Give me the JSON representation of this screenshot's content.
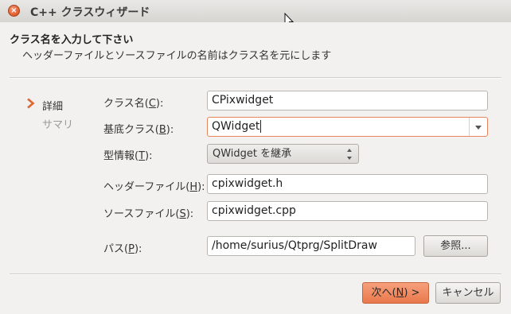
{
  "window": {
    "title": "C++ クラスウィザード",
    "close_symbol": "×"
  },
  "header": {
    "title": "クラス名を入力して下さい",
    "subtitle": "ヘッダーファイルとソースファイルの名前はクラス名を元にします"
  },
  "steps": {
    "current_marker": "❯",
    "details": "詳細",
    "summary": "サマリ"
  },
  "form": {
    "class_name": {
      "label": "クラス名",
      "mnemonic": "C",
      "value": "CPixwidget"
    },
    "base_class": {
      "label": "基底クラス",
      "mnemonic": "B",
      "value": "QWidget"
    },
    "type_info": {
      "label": "型情報",
      "mnemonic": "T",
      "value": "QWidget を継承"
    },
    "header_file": {
      "label": "ヘッダーファイル",
      "mnemonic": "H",
      "value": "cpixwidget.h"
    },
    "source_file": {
      "label": "ソースファイル",
      "mnemonic": "S",
      "value": "cpixwidget.cpp"
    },
    "path": {
      "label": "パス",
      "mnemonic": "P",
      "value": "/home/surius/Qtprg/SplitDraw"
    },
    "browse_label": "参照..."
  },
  "buttons": {
    "next_prefix": "次へ(",
    "next_mnemonic": "N",
    "next_suffix": ") >",
    "cancel": "キャンセル"
  },
  "colors": {
    "accent": "#e9784c",
    "window_bg": "#f2f1f0"
  }
}
